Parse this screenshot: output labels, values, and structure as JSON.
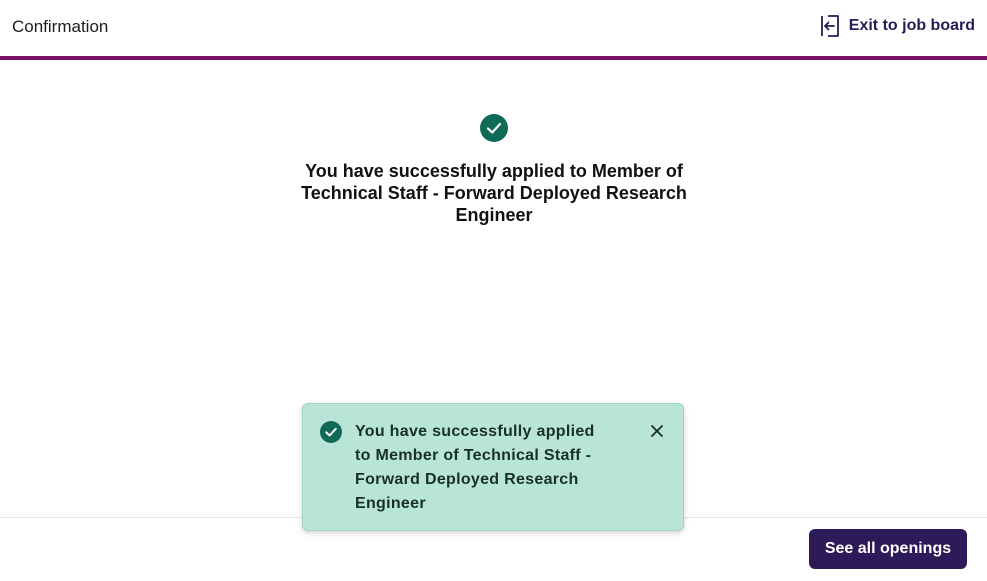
{
  "header": {
    "title": "Confirmation",
    "exit_label": "Exit to job board",
    "accent_color": "#7b0f63"
  },
  "main": {
    "heading": "You have successfully applied to Member of Technical Staff - Forward Deployed Research Engineer",
    "status_icon": "check-circle-icon",
    "success_color": "#0f6b55"
  },
  "toast": {
    "message": "You have successfully applied to Member of Technical Staff - Forward Deployed Research Engineer",
    "icon": "check-circle-icon",
    "close_icon": "close-icon",
    "background_color": "#b9e5d9"
  },
  "footer": {
    "see_all_label": "See all openings",
    "button_color": "#2c1b58"
  }
}
